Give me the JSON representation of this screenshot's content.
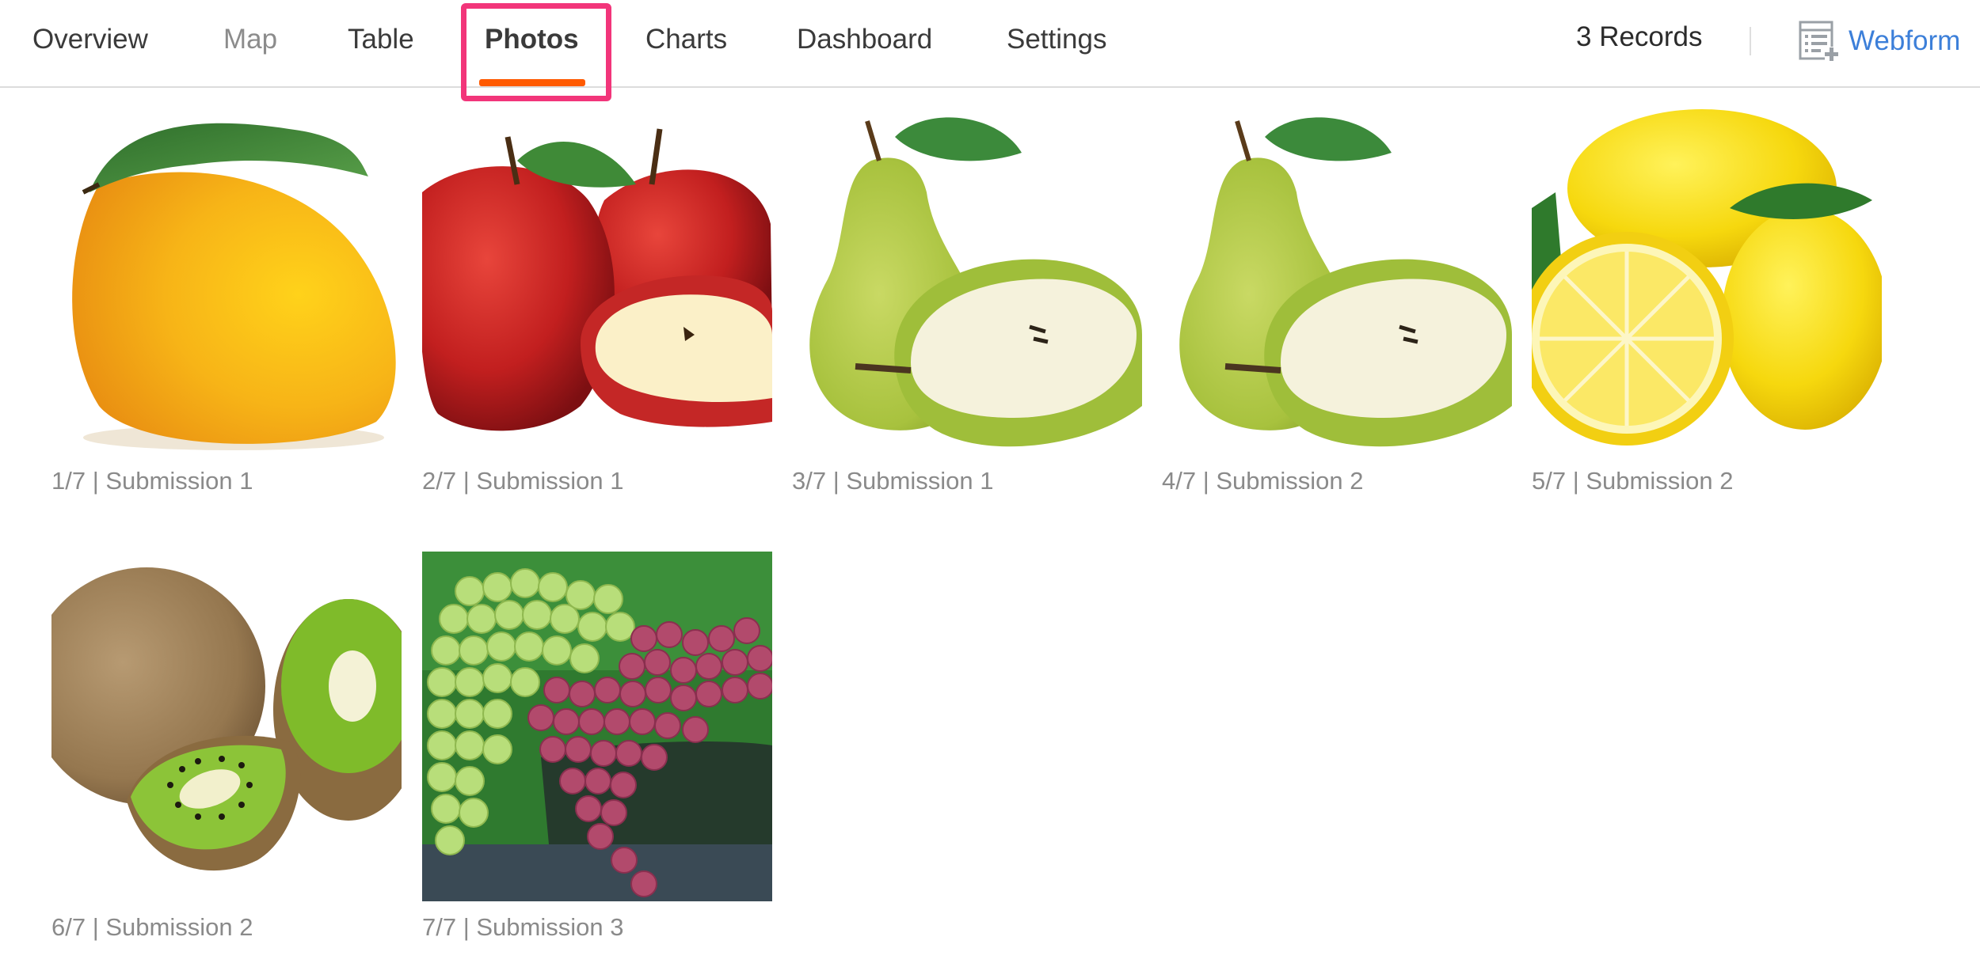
{
  "nav": {
    "tabs": [
      {
        "label": "Overview"
      },
      {
        "label": "Map"
      },
      {
        "label": "Table"
      },
      {
        "label": "Photos"
      },
      {
        "label": "Charts"
      },
      {
        "label": "Dashboard"
      },
      {
        "label": "Settings"
      }
    ],
    "active_tab": "Photos",
    "records": "3 Records",
    "webform": "Webform",
    "accent_color": "#ff5a00",
    "link_color": "#3c7fd9",
    "highlight_color": "#f2357a"
  },
  "photos": [
    {
      "caption": "1/7 | Submission 1",
      "subject": "mango"
    },
    {
      "caption": "2/7 | Submission 1",
      "subject": "red apples"
    },
    {
      "caption": "3/7 | Submission 1",
      "subject": "pears"
    },
    {
      "caption": "4/7 | Submission 2",
      "subject": "pears"
    },
    {
      "caption": "5/7 | Submission 2",
      "subject": "lemons"
    },
    {
      "caption": "6/7 | Submission 2",
      "subject": "kiwi"
    },
    {
      "caption": "7/7 | Submission 3",
      "subject": "grapes"
    }
  ]
}
